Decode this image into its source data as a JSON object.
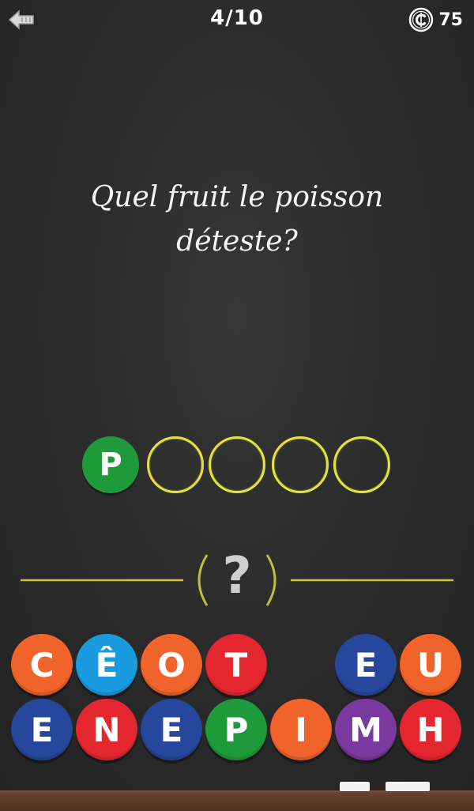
{
  "header": {
    "progress": "4/10",
    "coins": "75",
    "back_icon": "back-arrow-icon",
    "coin_icon": "coin-icon"
  },
  "question": {
    "line1": "Quel fruit le poisson",
    "line2": "déteste?"
  },
  "answer": {
    "slots": [
      "P",
      "",
      "",
      "",
      ""
    ],
    "slot_color": "#e6e23a",
    "filled_color": "#1f9a3a"
  },
  "hint": {
    "label": "?",
    "icon": "question-mark-icon"
  },
  "letters": {
    "row1": [
      {
        "letter": "C",
        "color": "#f0632a"
      },
      {
        "letter": "Ê",
        "color": "#1a9be0"
      },
      {
        "letter": "O",
        "color": "#f0632a"
      },
      {
        "letter": "T",
        "color": "#e4262f"
      },
      {
        "letter": "",
        "color": ""
      },
      {
        "letter": "E",
        "color": "#26479c"
      },
      {
        "letter": "U",
        "color": "#f0632a"
      }
    ],
    "row2": [
      {
        "letter": "E",
        "color": "#26479c"
      },
      {
        "letter": "N",
        "color": "#e4262f"
      },
      {
        "letter": "E",
        "color": "#26479c"
      },
      {
        "letter": "P",
        "color": "#1f9a3a"
      },
      {
        "letter": "I",
        "color": "#f0632a"
      },
      {
        "letter": "M",
        "color": "#7a3aa0"
      },
      {
        "letter": "H",
        "color": "#e4262f"
      }
    ]
  }
}
